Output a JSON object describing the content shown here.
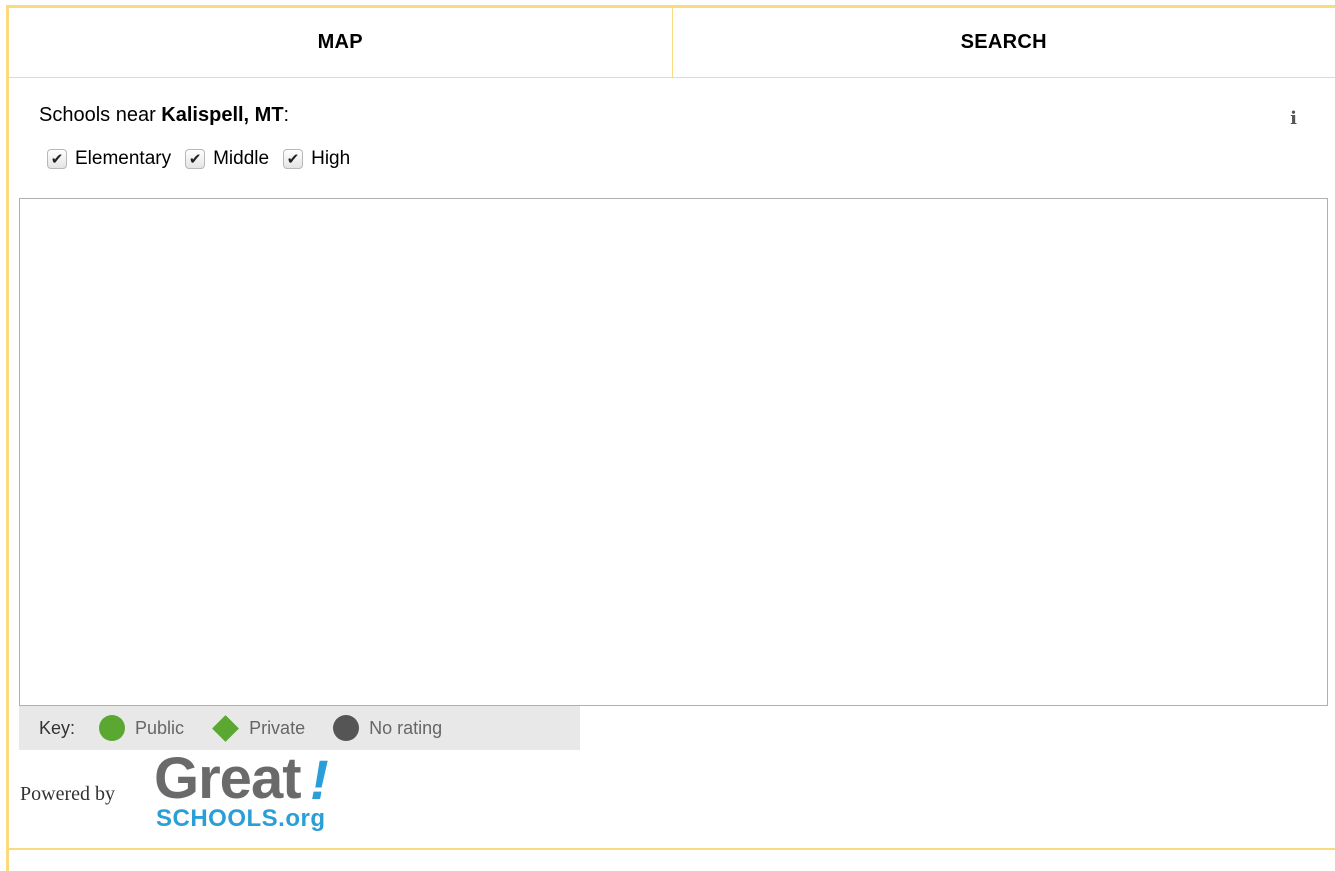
{
  "tabs": [
    {
      "label": "MAP"
    },
    {
      "label": "SEARCH"
    }
  ],
  "heading": {
    "prefix": "Schools near ",
    "location": "Kalispell, MT",
    "suffix": ":"
  },
  "info_icon": "info-icon",
  "filters": [
    {
      "label": "Elementary",
      "checked": true
    },
    {
      "label": "Middle",
      "checked": true
    },
    {
      "label": "High",
      "checked": true
    }
  ],
  "key": {
    "label": "Key:",
    "items": [
      {
        "label": "Public",
        "shape": "circle",
        "color": "#5aa832"
      },
      {
        "label": "Private",
        "shape": "diamond",
        "color": "#5aa832"
      },
      {
        "label": "No rating",
        "shape": "circle",
        "color": "#555555"
      }
    ]
  },
  "footer": {
    "powered_by": "Powered by",
    "logo_main": "Great",
    "logo_bang": "!",
    "logo_sub": "SCHOOLS.org"
  },
  "colors": {
    "accent_border": "#fbd97e",
    "logo_blue": "#2a9ed7"
  }
}
